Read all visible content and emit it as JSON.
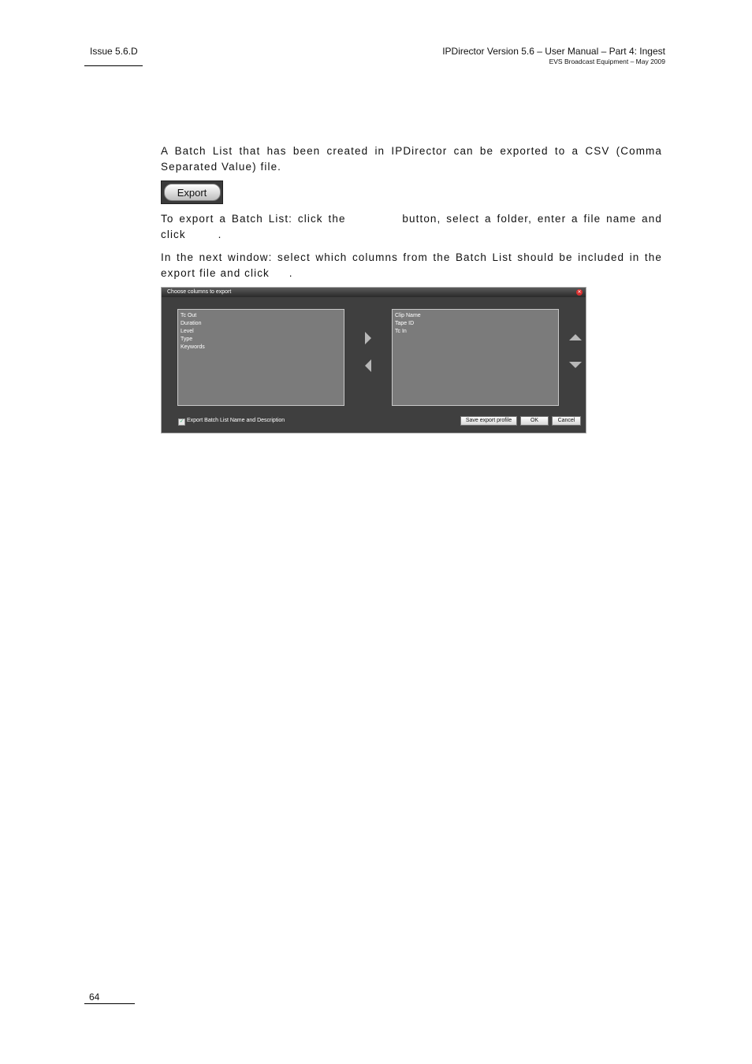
{
  "header": {
    "issue": "Issue 5.6.D",
    "title": "IPDirector Version 5.6 – User Manual – Part 4: Ingest",
    "subtitle": "EVS Broadcast Equipment – May 2009"
  },
  "body": {
    "para1": "A Batch List that has been created in IPDirector can be exported to a CSV (Comma Separated Value) file.",
    "export_button_label": "Export",
    "para2_a": "To export a Batch List: click the",
    "para2_b": "button, select a folder, enter a file name and click",
    "para2_c": ".",
    "para3_a": "In the next window: select which columns from the Batch List should be included in the export file and click",
    "para3_b": "."
  },
  "dialog": {
    "title": "Choose columns to export",
    "available_columns": [
      "Tc Out",
      "Duration",
      "Level",
      "Type",
      "Keywords"
    ],
    "selected_columns": [
      "Clip Name",
      "Tape ID",
      "Tc In"
    ],
    "checkbox_label": "Export Batch List Name and Description",
    "checkbox_checked": true,
    "buttons": {
      "save_profile": "Save export profile",
      "ok": "OK",
      "cancel": "Cancel"
    }
  },
  "footer": {
    "page_number": "64"
  }
}
